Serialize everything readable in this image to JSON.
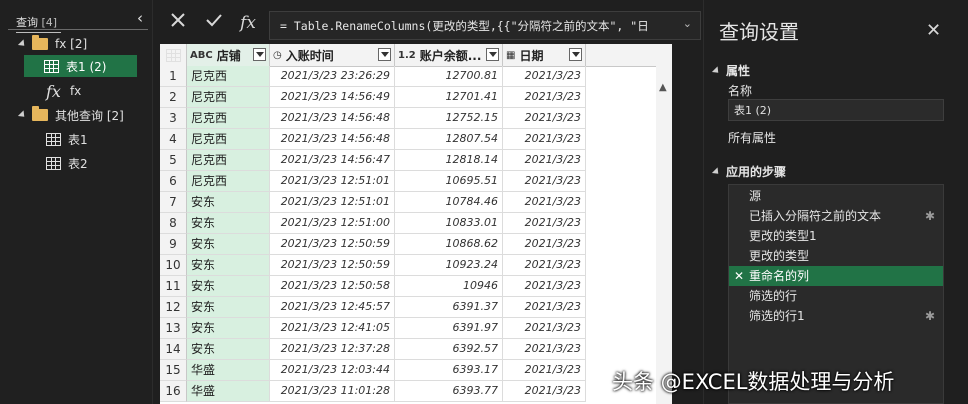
{
  "queries_pane": {
    "header": "查询",
    "count": "[4]",
    "items": [
      {
        "label": "fx [2]",
        "kind": "folder"
      },
      {
        "label": "表1 (2)",
        "kind": "table",
        "selected": true
      },
      {
        "label": "fx",
        "kind": "function"
      },
      {
        "label": "其他查询 [2]",
        "kind": "folder"
      },
      {
        "label": "表1",
        "kind": "table"
      },
      {
        "label": "表2",
        "kind": "table"
      }
    ]
  },
  "formula_bar": {
    "cancel_icon": "close-icon",
    "commit_icon": "check-icon",
    "fx_label": "fx",
    "formula": "= Table.RenameColumns(更改的类型,{{\"分隔符之前的文本\", \"日"
  },
  "grid": {
    "columns": [
      {
        "label": "店铺",
        "type_icon": "ABC"
      },
      {
        "label": "入账时间",
        "type_icon": "◷"
      },
      {
        "label": "账户余额...",
        "type_icon": "1.2"
      },
      {
        "label": "日期",
        "type_icon": "▦"
      }
    ],
    "rows": [
      {
        "n": "1",
        "store": "尼克西",
        "time": "2021/3/23 23:26:29",
        "balance": "12700.81",
        "date": "2021/3/23"
      },
      {
        "n": "2",
        "store": "尼克西",
        "time": "2021/3/23 14:56:49",
        "balance": "12701.41",
        "date": "2021/3/23"
      },
      {
        "n": "3",
        "store": "尼克西",
        "time": "2021/3/23 14:56:48",
        "balance": "12752.15",
        "date": "2021/3/23"
      },
      {
        "n": "4",
        "store": "尼克西",
        "time": "2021/3/23 14:56:48",
        "balance": "12807.54",
        "date": "2021/3/23"
      },
      {
        "n": "5",
        "store": "尼克西",
        "time": "2021/3/23 14:56:47",
        "balance": "12818.14",
        "date": "2021/3/23"
      },
      {
        "n": "6",
        "store": "尼克西",
        "time": "2021/3/23 12:51:01",
        "balance": "10695.51",
        "date": "2021/3/23"
      },
      {
        "n": "7",
        "store": "安东",
        "time": "2021/3/23 12:51:01",
        "balance": "10784.46",
        "date": "2021/3/23"
      },
      {
        "n": "8",
        "store": "安东",
        "time": "2021/3/23 12:51:00",
        "balance": "10833.01",
        "date": "2021/3/23"
      },
      {
        "n": "9",
        "store": "安东",
        "time": "2021/3/23 12:50:59",
        "balance": "10868.62",
        "date": "2021/3/23"
      },
      {
        "n": "10",
        "store": "安东",
        "time": "2021/3/23 12:50:59",
        "balance": "10923.24",
        "date": "2021/3/23"
      },
      {
        "n": "11",
        "store": "安东",
        "time": "2021/3/23 12:50:58",
        "balance": "10946",
        "date": "2021/3/23"
      },
      {
        "n": "12",
        "store": "安东",
        "time": "2021/3/23 12:45:57",
        "balance": "6391.37",
        "date": "2021/3/23"
      },
      {
        "n": "13",
        "store": "安东",
        "time": "2021/3/23 12:41:05",
        "balance": "6391.97",
        "date": "2021/3/23"
      },
      {
        "n": "14",
        "store": "安东",
        "time": "2021/3/23 12:37:28",
        "balance": "6392.57",
        "date": "2021/3/23"
      },
      {
        "n": "15",
        "store": "华盛",
        "time": "2021/3/23 12:03:44",
        "balance": "6393.17",
        "date": "2021/3/23"
      },
      {
        "n": "16",
        "store": "华盛",
        "time": "2021/3/23 11:01:28",
        "balance": "6393.77",
        "date": "2021/3/23"
      }
    ]
  },
  "settings_pane": {
    "title": "查询设置",
    "properties_header": "属性",
    "name_label": "名称",
    "name_value": "表1 (2)",
    "all_properties": "所有属性",
    "steps_header": "应用的步骤",
    "steps": [
      {
        "label": "源",
        "gear": false
      },
      {
        "label": "已插入分隔符之前的文本",
        "gear": true
      },
      {
        "label": "更改的类型1",
        "gear": false
      },
      {
        "label": "更改的类型",
        "gear": false
      },
      {
        "label": "重命名的列",
        "gear": false,
        "active": true
      },
      {
        "label": "筛选的行",
        "gear": false
      },
      {
        "label": "筛选的行1",
        "gear": true
      }
    ]
  },
  "watermark": "头条 @EXCEL数据处理与分析",
  "colors": {
    "accent": "#217346",
    "selected_column": "#d8f0e0",
    "background": "#1f1f1f"
  }
}
